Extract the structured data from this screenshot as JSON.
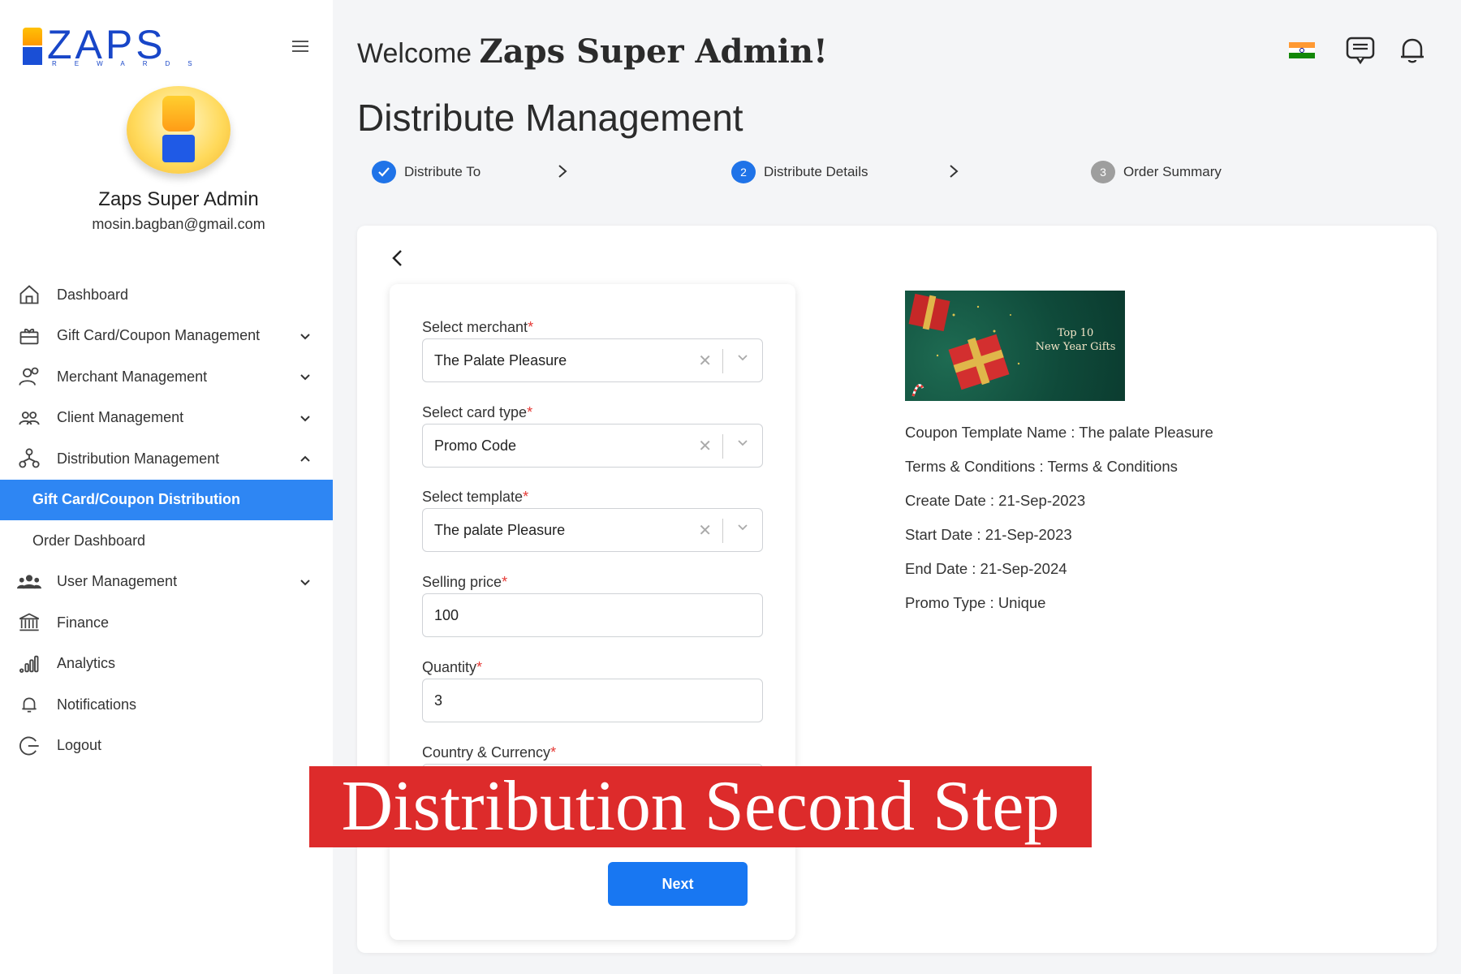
{
  "brand": {
    "name": "ZAPS",
    "sub": "REWARDS"
  },
  "profile": {
    "name": "Zaps Super Admin",
    "email": "mosin.bagban@gmail.com"
  },
  "nav": [
    {
      "label": "Dashboard",
      "icon": "home-icon"
    },
    {
      "label": "Gift Card/Coupon Management",
      "icon": "gift-icon",
      "expandable": true
    },
    {
      "label": "Merchant Management",
      "icon": "merchant-icon",
      "expandable": true
    },
    {
      "label": "Client Management",
      "icon": "clients-icon",
      "expandable": true
    },
    {
      "label": "Distribution Management",
      "icon": "distribution-icon",
      "expandable": true,
      "expanded": true
    },
    {
      "label": "Gift Card/Coupon Distribution",
      "sub": true,
      "active": true
    },
    {
      "label": "Order Dashboard",
      "sub": true
    },
    {
      "label": "User Management",
      "icon": "users-icon",
      "expandable": true
    },
    {
      "label": "Finance",
      "icon": "bank-icon"
    },
    {
      "label": "Analytics",
      "icon": "analytics-icon"
    },
    {
      "label": "Notifications",
      "icon": "bell-icon"
    },
    {
      "label": "Logout",
      "icon": "logout-icon"
    }
  ],
  "header": {
    "welcome_prefix": "Welcome",
    "welcome_name": "Zaps Super Admin!",
    "icons": [
      "india-flag-icon",
      "chat-icon",
      "bell-icon"
    ]
  },
  "page_title": "Distribute Management",
  "steps": [
    {
      "label": "Distribute To",
      "status": "done"
    },
    {
      "number": "2",
      "label": "Distribute Details",
      "status": "active"
    },
    {
      "number": "3",
      "label": "Order Summary",
      "status": "pending"
    }
  ],
  "form": {
    "merchant": {
      "label": "Select merchant",
      "value": "The Palate Pleasure"
    },
    "card_type": {
      "label": "Select card type",
      "value": "Promo Code"
    },
    "template": {
      "label": "Select template",
      "value": "The palate Pleasure"
    },
    "selling_price": {
      "label": "Selling price",
      "value": "100"
    },
    "quantity": {
      "label": "Quantity",
      "value": "3"
    },
    "country_currency": {
      "label": "Country & Currency"
    },
    "required_mark": "*",
    "next_label": "Next"
  },
  "template_preview": {
    "caption_line1": "Top 10",
    "caption_line2": "New Year Gifts",
    "details": [
      "Coupon Template Name : The palate Pleasure",
      "Terms & Conditions : Terms & Conditions",
      "Create Date : 21-Sep-2023",
      "Start Date : 21-Sep-2023",
      "End Date : 21-Sep-2024",
      "Promo Type : Unique"
    ]
  },
  "banner": {
    "text": "Distribution Second Step",
    "color": "#dd2b2b"
  },
  "colors": {
    "accent": "#2e86f3",
    "button": "#1877f2",
    "brand": "#1846c8",
    "required": "#e53935"
  }
}
